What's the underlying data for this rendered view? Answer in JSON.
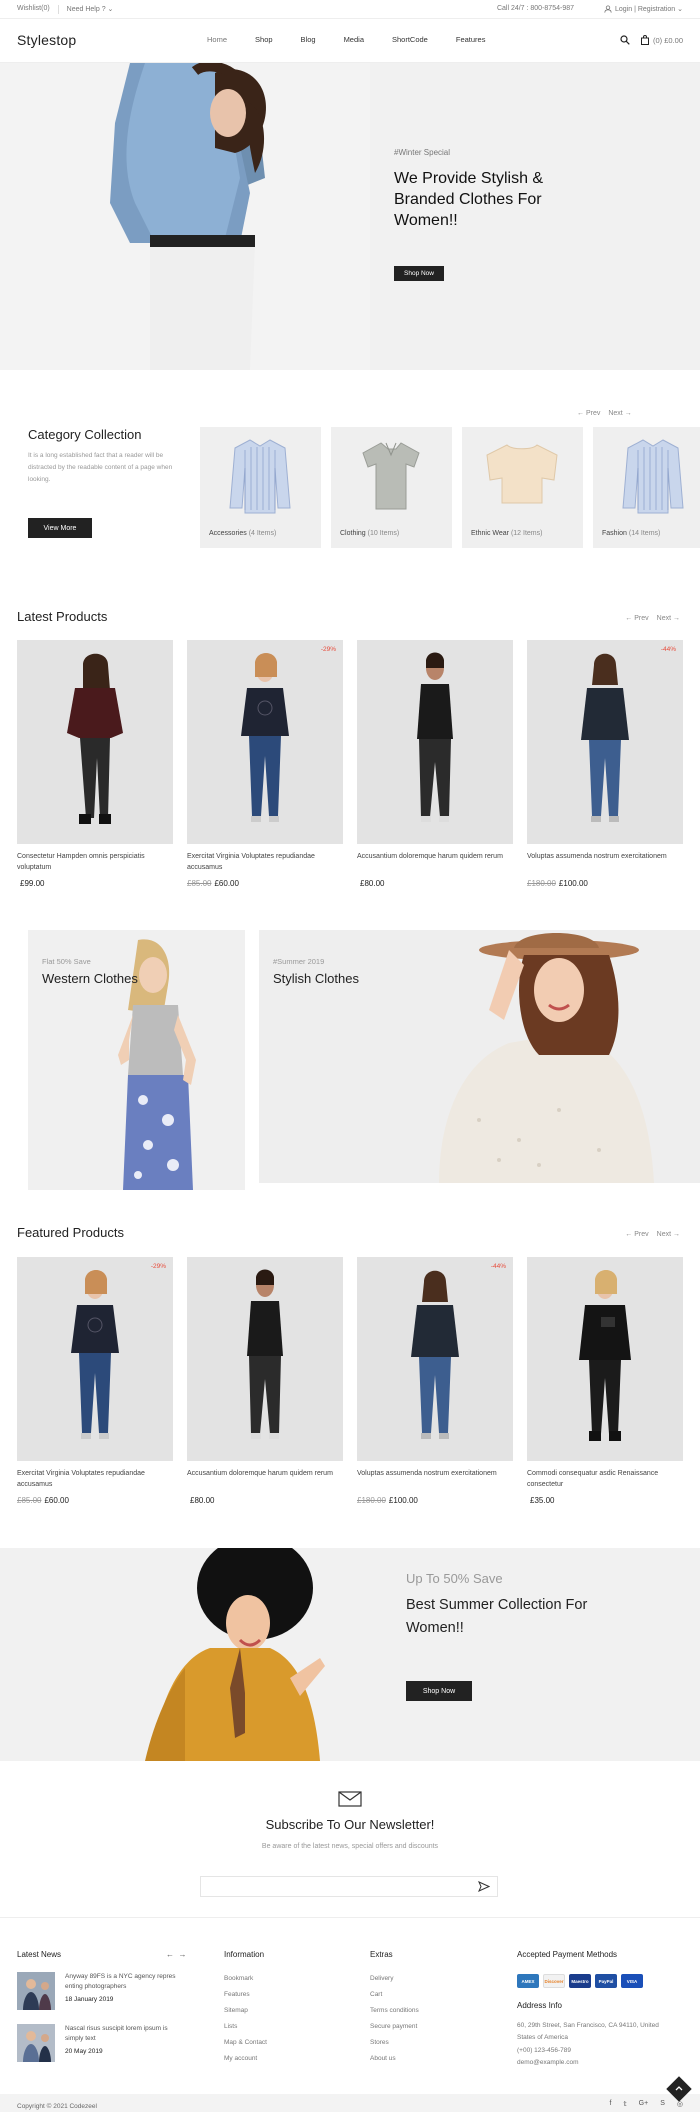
{
  "topbar": {
    "wishlist": "Wishlist(0)",
    "help": "Need Help ? ⌄",
    "call": "Call 24/7 : 800-8754-987",
    "login": "Login | Registration ⌄"
  },
  "header": {
    "logo": "Stylestop",
    "nav": [
      "Home",
      "Shop",
      "Blog",
      "Media",
      "ShortCode",
      "Features"
    ],
    "cart": "(0) £0.00"
  },
  "hero": {
    "tag": "#Winter Special",
    "title": "We Provide Stylish & Branded Clothes For Women!!",
    "button": "Shop Now"
  },
  "category": {
    "prev": "Prev",
    "next": "Next",
    "title": "Category Collection",
    "desc": "It is a long established fact that a reader will be distracted by the readable content of a page when looking.",
    "button": "View More",
    "items": [
      {
        "name": "Accessories",
        "count": "(4 Items)"
      },
      {
        "name": "Clothing",
        "count": "(10 Items)"
      },
      {
        "name": "Ethnic Wear",
        "count": "(12 Items)"
      },
      {
        "name": "Fashion",
        "count": "(14 Items)"
      }
    ]
  },
  "latest": {
    "title": "Latest Products",
    "prev": "Prev",
    "next": "Next",
    "products": [
      {
        "name": "Consectetur Hampden omnis perspiciatis voluptatum",
        "old": "",
        "price": "£99.00",
        "badge": ""
      },
      {
        "name": "Exercitat Virginia Voluptates repudiandae accusamus",
        "old": "£85.00",
        "price": "£60.00",
        "badge": "-29%"
      },
      {
        "name": "Accusantium doloremque harum quidem rerum",
        "old": "",
        "price": "£80.00",
        "badge": ""
      },
      {
        "name": "Voluptas assumenda nostrum exercitationem",
        "old": "£180.00",
        "price": "£100.00",
        "badge": "-44%"
      }
    ]
  },
  "banners": {
    "left_tag": "Flat 50% Save",
    "left_title": "Western Clothes",
    "right_tag": "#Summer 2019",
    "right_title": "Stylish Clothes"
  },
  "featured": {
    "title": "Featured Products",
    "prev": "Prev",
    "next": "Next",
    "products": [
      {
        "name": "Exercitat Virginia Voluptates repudiandae accusamus",
        "old": "£85.00",
        "price": "£60.00",
        "badge": "-29%"
      },
      {
        "name": "Accusantium doloremque harum quidem rerum",
        "old": "",
        "price": "£80.00",
        "badge": ""
      },
      {
        "name": "Voluptas assumenda nostrum exercitationem",
        "old": "£180.00",
        "price": "£100.00",
        "badge": "-44%"
      },
      {
        "name": "Commodi consequatur asdic Renaissance consectetur",
        "old": "",
        "price": "£35.00",
        "badge": ""
      }
    ]
  },
  "summer": {
    "up": "Up To 50% Save",
    "title": "Best Summer Collection For Women!!",
    "button": "Shop Now"
  },
  "newsletter": {
    "title": "Subscribe To Our Newsletter!",
    "sub": "Be aware of the latest news, special offers and discounts",
    "placeholder": ""
  },
  "footer": {
    "news_title": "Latest News",
    "news": [
      {
        "text": "Anyway 89FS is a NYC agency repres enting photographers",
        "date": "18 January 2019"
      },
      {
        "text": "Nascal risus suscipit lorem ipsum is simply text",
        "date": "20 May 2019"
      }
    ],
    "info_title": "Information",
    "info_links": [
      "Bookmark",
      "Features",
      "Sitemap",
      "Lists",
      "Map & Contact",
      "My account"
    ],
    "extras_title": "Extras",
    "extras_links": [
      "Delivery",
      "Cart",
      "Terms conditions",
      "Secure payment",
      "Stores",
      "About us"
    ],
    "payment_title": "Accepted Payment Methods",
    "payments": [
      "AMEX",
      "Discover",
      "Maestro",
      "PayPal",
      "VISA"
    ],
    "address_title": "Address Info",
    "address": "60, 29th Street, San Francisco, CA 94110, United States of America",
    "phone": "(+00) 123-456-789",
    "email": "demo@example.com",
    "copyright": "Copyright © 2021 Codezeel"
  }
}
